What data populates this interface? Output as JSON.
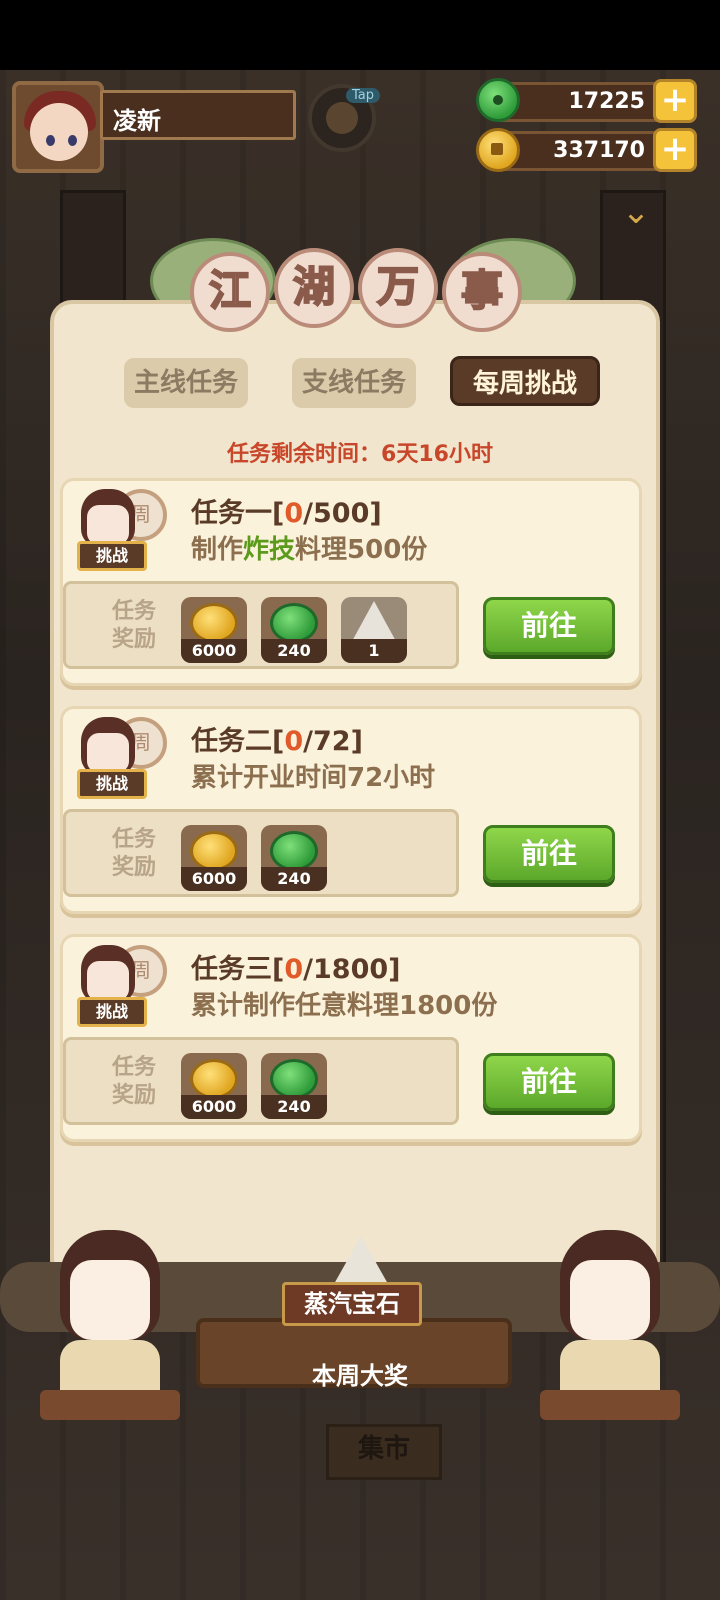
{
  "player": {
    "name": "凌新"
  },
  "top_button": {
    "tag": "Tap"
  },
  "currency": {
    "jade": {
      "value": "17225",
      "icon": "jade-icon",
      "plus": "+"
    },
    "coin": {
      "value": "337170",
      "icon": "coin-icon",
      "plus": "+"
    }
  },
  "title": {
    "chars": [
      "江",
      "湖",
      "万",
      "事"
    ]
  },
  "tabs": [
    {
      "label": "主线任务",
      "active": false
    },
    {
      "label": "支线任务",
      "active": false
    },
    {
      "label": "每周挑战",
      "active": true
    }
  ],
  "remaining": {
    "label": "任务剩余时间：",
    "value": "6天16小时"
  },
  "tasks": [
    {
      "title_prefix": "任务一[",
      "progress_current": "0",
      "progress_rest": "/500]",
      "desc_prefix": "制作",
      "desc_highlight": "炸技",
      "desc_suffix": "料理500份",
      "portrait_badge": "挑战",
      "portrait_gong": "周",
      "reward_label_line1": "任务",
      "reward_label_line2": "奖励",
      "rewards": [
        {
          "icon": "coin-icon",
          "amount": "6000"
        },
        {
          "icon": "jade-icon",
          "amount": "240"
        },
        {
          "icon": "steam-gem-icon",
          "amount": "1"
        }
      ],
      "button": "前往"
    },
    {
      "title_prefix": "任务二[",
      "progress_current": "0",
      "progress_rest": "/72]",
      "desc_prefix": "累计开业时间72小时",
      "desc_highlight": "",
      "desc_suffix": "",
      "portrait_badge": "挑战",
      "portrait_gong": "周",
      "reward_label_line1": "任务",
      "reward_label_line2": "奖励",
      "rewards": [
        {
          "icon": "coin-icon",
          "amount": "6000"
        },
        {
          "icon": "jade-icon",
          "amount": "240"
        }
      ],
      "button": "前往"
    },
    {
      "title_prefix": "任务三[",
      "progress_current": "0",
      "progress_rest": "/1800]",
      "desc_prefix": "累计制作任意料理1800份",
      "desc_highlight": "",
      "desc_suffix": "",
      "portrait_badge": "挑战",
      "portrait_gong": "周",
      "reward_label_line1": "任务",
      "reward_label_line2": "奖励",
      "rewards": [
        {
          "icon": "coin-icon",
          "amount": "6000"
        },
        {
          "icon": "jade-icon",
          "amount": "240"
        }
      ],
      "button": "前往"
    }
  ],
  "grand_prize": {
    "item": "蒸汽宝石",
    "label": "本周大奖"
  },
  "background": {
    "sign": "集市"
  },
  "colors": {
    "accent_green": "#5ca82a",
    "remaining_red": "#c8472a",
    "progress_orange": "#e05a2a",
    "highlight_green": "#5c9a1c"
  }
}
